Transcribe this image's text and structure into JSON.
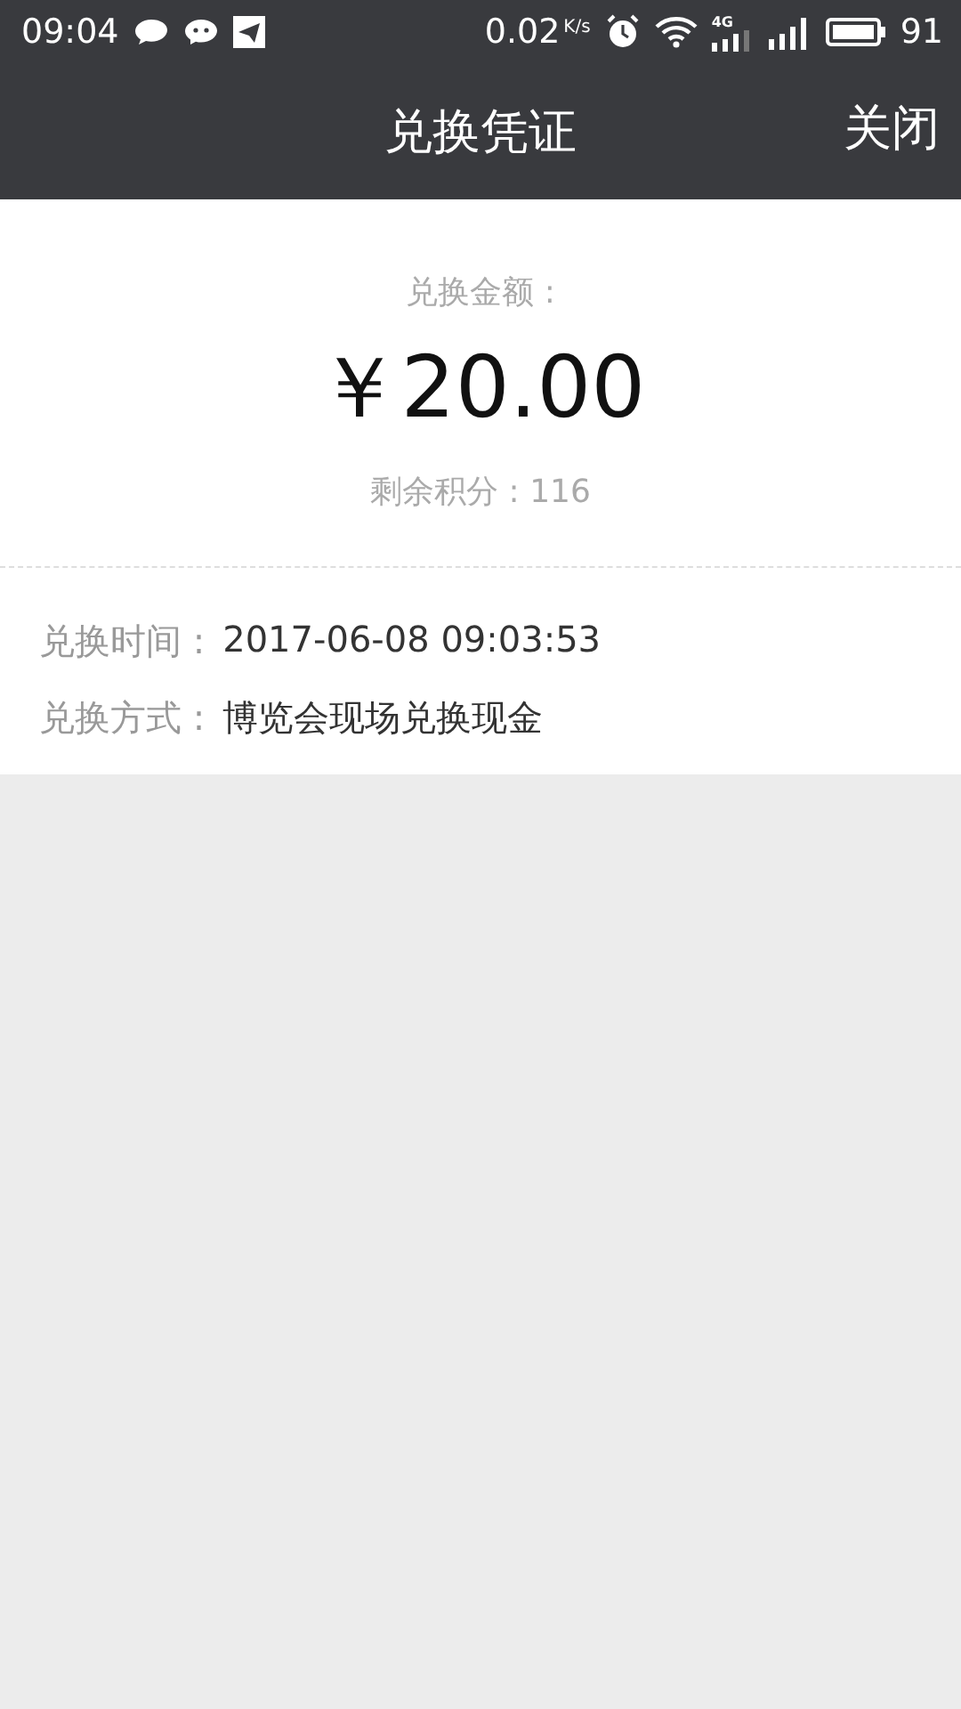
{
  "status_bar": {
    "time": "09:04",
    "speed": "0.02",
    "speed_unit": "K/s",
    "network": "4G",
    "battery": "91"
  },
  "header": {
    "title": "兑换凭证",
    "close": "关闭"
  },
  "summary": {
    "label": "兑换金额 :",
    "amount": "￥20.00",
    "remaining": "剩余积分 : 116"
  },
  "details": [
    {
      "label": "兑换时间 :",
      "value": "2017-06-08 09:03:53"
    },
    {
      "label": "兑换方式 :",
      "value": "博览会现场兑换现金"
    }
  ]
}
